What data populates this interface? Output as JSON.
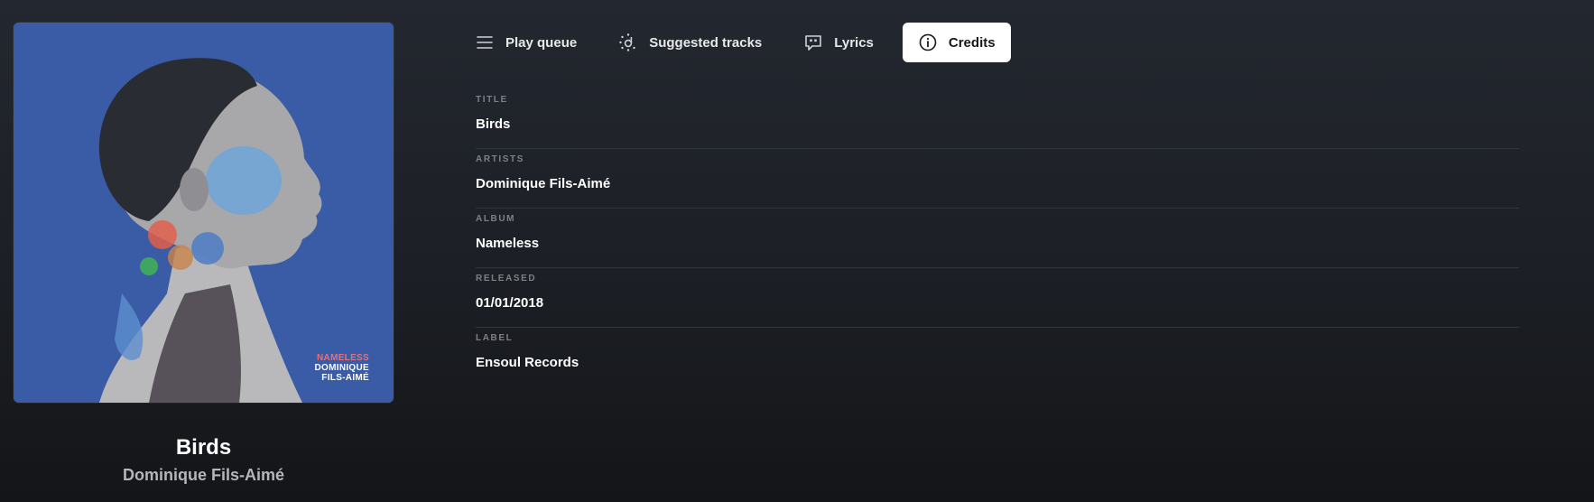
{
  "now_playing": {
    "title": "Birds",
    "artist": "Dominique Fils-Aimé",
    "cover": {
      "line1": "NAMELESS",
      "line2": "DOMINIQUE",
      "line3": "FILS-AIMÉ",
      "background_color": "#3a5ba5",
      "accent_color": "#e6707a"
    }
  },
  "tabs": [
    {
      "label": "Play queue",
      "icon": "list-icon",
      "active": false
    },
    {
      "label": "Suggested tracks",
      "icon": "suggested-icon",
      "active": false
    },
    {
      "label": "Lyrics",
      "icon": "lyrics-icon",
      "active": false
    },
    {
      "label": "Credits",
      "icon": "info-icon",
      "active": true
    }
  ],
  "credits": [
    {
      "label": "TITLE",
      "value": "Birds"
    },
    {
      "label": "ARTISTS",
      "value": "Dominique Fils-Aimé"
    },
    {
      "label": "ALBUM",
      "value": "Nameless"
    },
    {
      "label": "RELEASED",
      "value": "01/01/2018"
    },
    {
      "label": "LABEL",
      "value": "Ensoul Records"
    }
  ]
}
